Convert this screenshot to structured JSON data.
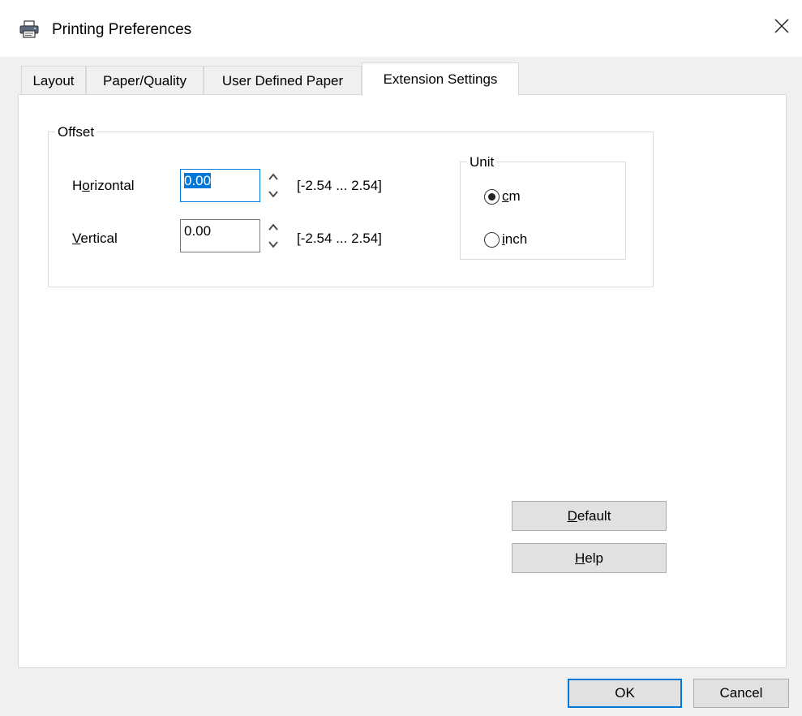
{
  "window": {
    "title": "Printing Preferences"
  },
  "tabs": [
    {
      "label": "Layout"
    },
    {
      "label": "Paper/Quality"
    },
    {
      "label": "User Defined Paper"
    },
    {
      "label": "Extension Settings",
      "active": true
    }
  ],
  "offset": {
    "group_label": "Offset",
    "horizontal": {
      "label_accel": "o",
      "label_pre": "H",
      "label_post": "rizontal",
      "value": "0.00",
      "range": "[-2.54 ... 2.54]"
    },
    "vertical": {
      "label_accel": "V",
      "label_post": "ertical",
      "value": "0.00",
      "range": "[-2.54 ... 2.54]"
    }
  },
  "unit": {
    "group_label": "Unit",
    "options": [
      {
        "accel": "c",
        "rest": "m",
        "selected": true
      },
      {
        "accel": "i",
        "rest": "nch",
        "selected": false
      }
    ]
  },
  "buttons": {
    "default": {
      "accel": "D",
      "rest": "efault"
    },
    "help": {
      "accel": "H",
      "rest": "elp"
    },
    "ok": "OK",
    "cancel": "Cancel"
  },
  "icons": {
    "window": "printer-icon",
    "close": "close-icon",
    "spinner": "spinner-arrows-icon"
  },
  "colors": {
    "accent": "#0078d7",
    "panel": "#ffffff",
    "chrome": "#f0f0f0"
  }
}
